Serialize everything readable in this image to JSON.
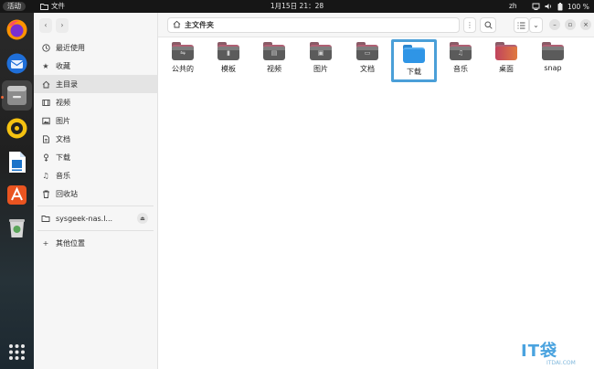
{
  "topbar": {
    "activities": "活动",
    "app_name": "文件",
    "clock": "1月15日  21：28",
    "lang": "zh",
    "battery": "100 %"
  },
  "dock": {
    "icons": [
      "firefox-icon",
      "thunderbird-icon",
      "files-icon",
      "rhythmbox-icon",
      "libreoffice-writer-icon",
      "app-center-icon",
      "trash-icon",
      "show-apps-icon"
    ]
  },
  "sidebar": {
    "items": [
      {
        "label": "最近使用",
        "icon": "clock-icon"
      },
      {
        "label": "收藏",
        "icon": "star-icon"
      },
      {
        "label": "主目录",
        "icon": "home-icon"
      },
      {
        "label": "视频",
        "icon": "film-icon"
      },
      {
        "label": "图片",
        "icon": "image-icon"
      },
      {
        "label": "文档",
        "icon": "document-icon"
      },
      {
        "label": "下载",
        "icon": "download-icon"
      },
      {
        "label": "音乐",
        "icon": "music-icon"
      },
      {
        "label": "回收站",
        "icon": "trash-icon"
      }
    ],
    "network": {
      "label": "sysgeek-nas.l...",
      "icon": "network-drive-icon"
    },
    "other": {
      "label": "其他位置",
      "icon": "plus-icon"
    }
  },
  "header": {
    "path": "主文件夹"
  },
  "files": [
    {
      "label": "公共的",
      "glyph": "⇋"
    },
    {
      "label": "模板",
      "glyph": "▮"
    },
    {
      "label": "视频",
      "glyph": "▤"
    },
    {
      "label": "图片",
      "glyph": "▣"
    },
    {
      "label": "文档",
      "glyph": "▭"
    },
    {
      "label": "下载",
      "glyph": ""
    },
    {
      "label": "音乐",
      "glyph": "♫"
    },
    {
      "label": "桌面",
      "glyph": ""
    },
    {
      "label": "snap",
      "glyph": ""
    }
  ],
  "watermark": {
    "logo": "IT袋",
    "url": "ITDAI.COM"
  }
}
